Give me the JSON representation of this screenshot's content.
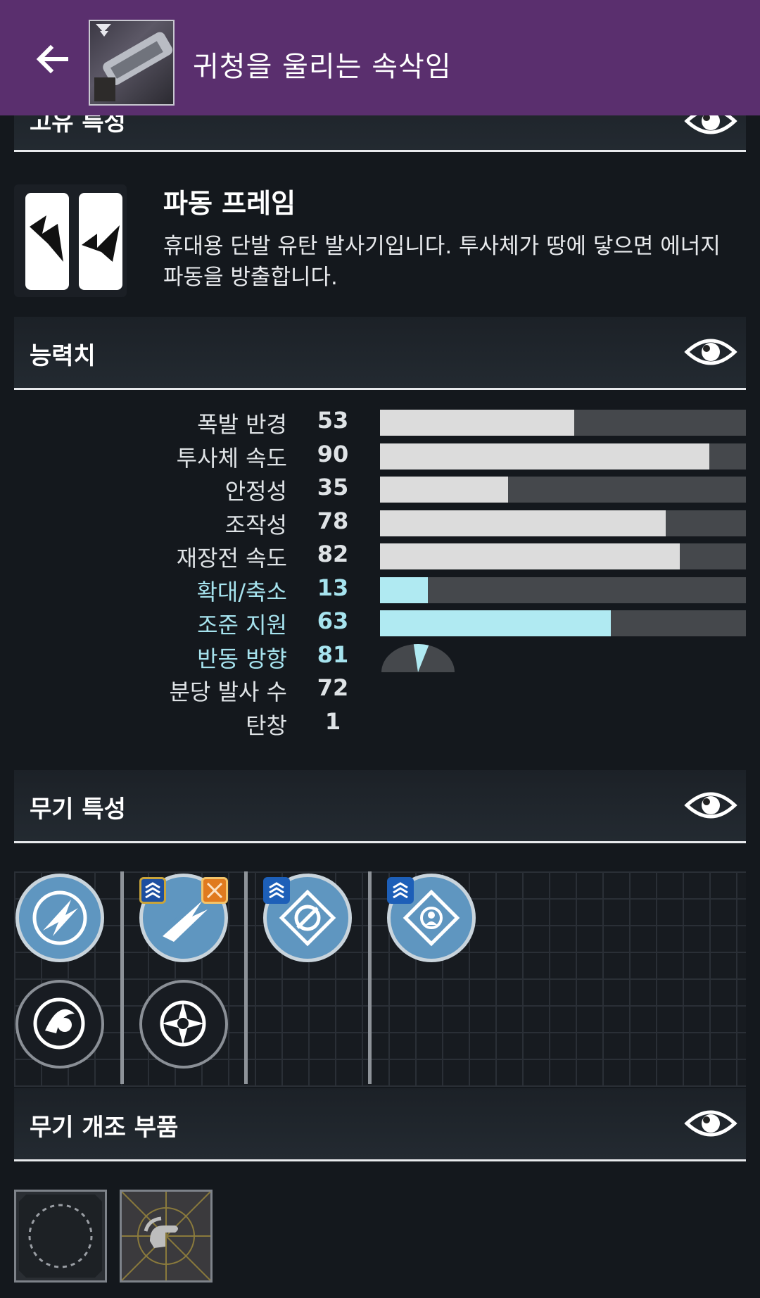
{
  "appbar": {
    "title": "귀청을 울리는 속삭임",
    "back_icon": "arrow-left-icon"
  },
  "sections": {
    "partial_top": "고유 특성",
    "stats": "능력치",
    "perks": "무기 특성",
    "mods": "무기 개조 부품"
  },
  "frame": {
    "name": "파동 프레임",
    "description": "휴대용 단발 유탄 발사기입니다. 투사체가 땅에 닿으면 에너지 파동을 방출합니다."
  },
  "stats": [
    {
      "label": "폭발 반경",
      "value": 53,
      "bar": true,
      "hidden": false
    },
    {
      "label": "투사체 속도",
      "value": 90,
      "bar": true,
      "hidden": false
    },
    {
      "label": "안정성",
      "value": 35,
      "bar": true,
      "hidden": false
    },
    {
      "label": "조작성",
      "value": 78,
      "bar": true,
      "hidden": false
    },
    {
      "label": "재장전 속도",
      "value": 82,
      "bar": true,
      "hidden": false
    },
    {
      "label": "확대/축소",
      "value": 13,
      "bar": true,
      "hidden": true
    },
    {
      "label": "조준 지원",
      "value": 63,
      "bar": true,
      "hidden": true
    },
    {
      "label": "반동 방향",
      "value": 81,
      "bar": false,
      "hidden": true
    },
    {
      "label": "분당 발사 수",
      "value": 72,
      "bar": false,
      "hidden": false
    },
    {
      "label": "탄창",
      "value": 1,
      "bar": false,
      "hidden": false
    }
  ],
  "colors": {
    "appbar": "#5a2f6e",
    "stat_bar": "#dcdcdc",
    "hidden_stat": "#a6e3ee",
    "perk_selected": "#5f96c0",
    "badge_blue": "#1d5fb8",
    "badge_gold": "#c9a43a",
    "badge_orange": "#e07a1f"
  },
  "icons": {
    "eye": "eye-icon",
    "frame": "wave-frame-icon",
    "perks": [
      "launcher-barrel-icon",
      "spike-grenades-icon",
      "auto-loading-holster-icon",
      "target-lock-icon",
      "impact-casing-icon",
      "bullseye-sight-icon"
    ],
    "mods": [
      "empty-mod-socket-icon",
      "handling-mod-icon"
    ]
  }
}
